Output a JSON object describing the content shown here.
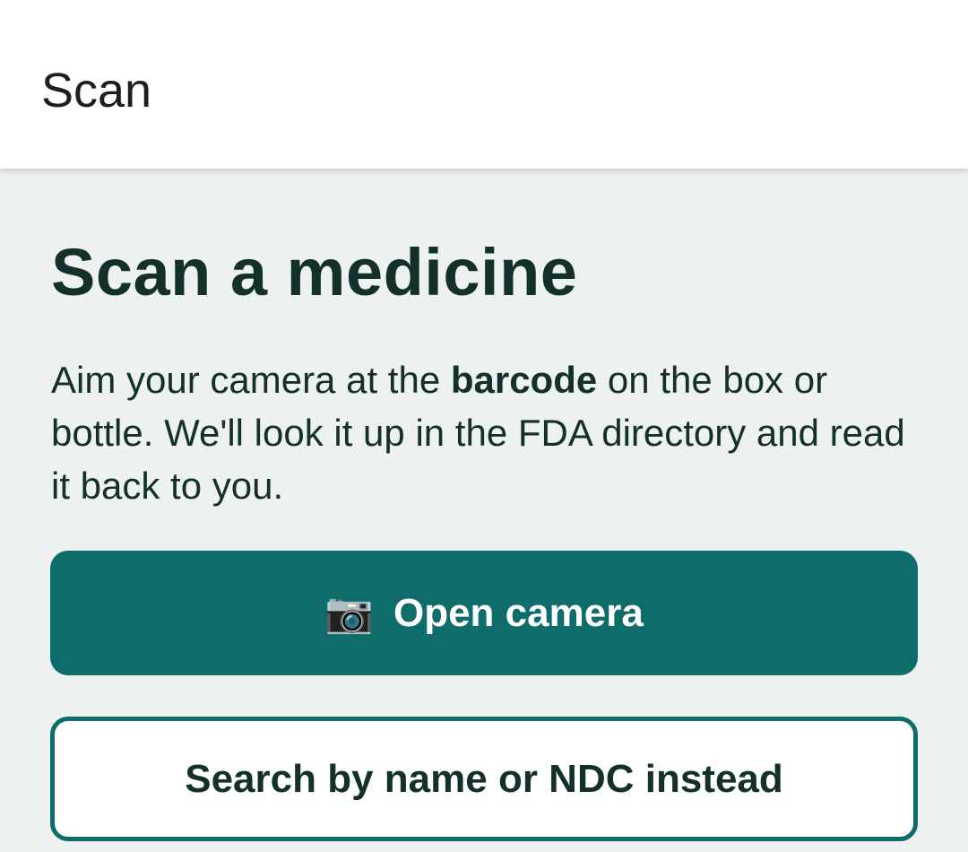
{
  "app_bar": {
    "title": "Scan"
  },
  "main": {
    "heading": "Scan a medicine",
    "instructions": {
      "before": "Aim your camera at the ",
      "emphasis": "barcode",
      "after": " on the box or bottle. We'll look it up in the FDA directory and read it back to you."
    },
    "primary_button": {
      "icon": "camera-icon",
      "icon_glyph": "📷",
      "label": "Open camera"
    },
    "secondary_button": {
      "label": "Search by name or NDC instead"
    }
  },
  "colors": {
    "accent": "#0e6c6a",
    "text": "#14302a",
    "background": "#edf1f0",
    "app_bar": "#ffffff"
  }
}
